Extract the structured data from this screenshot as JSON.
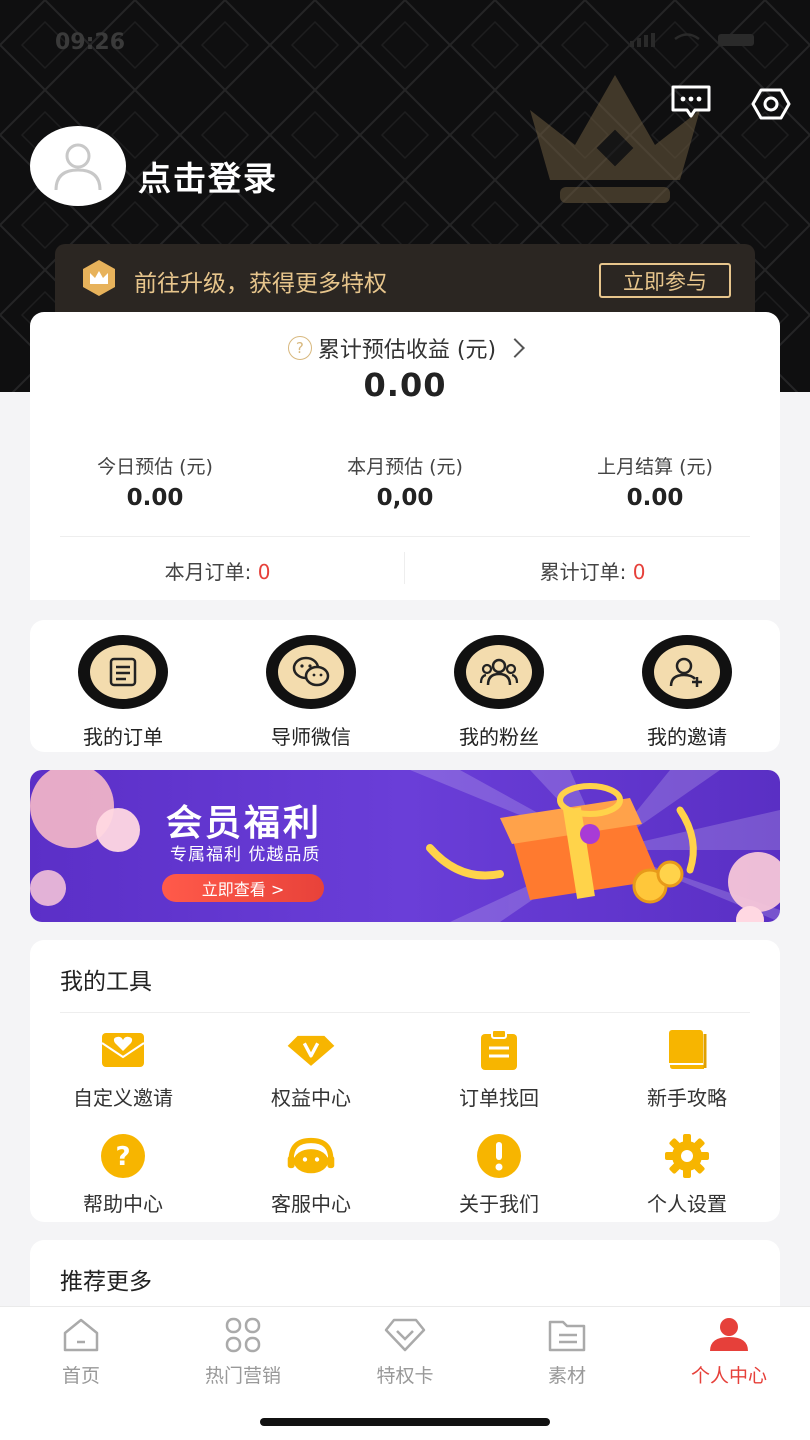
{
  "status_bar": {
    "time": "09:26"
  },
  "header": {
    "login_text": "点击登录",
    "upgrade_text": "前往升级，获得更多特权",
    "upgrade_button": "立即参与"
  },
  "earnings": {
    "total_label": "累计预估收益 (元)",
    "total_value": "0.00",
    "stats": [
      {
        "label": "今日预估 (元)",
        "value": "0.00"
      },
      {
        "label": "本月预估 (元)",
        "value": "0,00"
      },
      {
        "label": "上月结算 (元)",
        "value": "0.00"
      }
    ],
    "orders": [
      {
        "label": "本月订单: ",
        "value": "0"
      },
      {
        "label": "累计订单: ",
        "value": "0"
      }
    ]
  },
  "quick_actions": [
    {
      "label": "我的订单",
      "icon": "order-list-icon"
    },
    {
      "label": "导师微信",
      "icon": "wechat-icon"
    },
    {
      "label": "我的粉丝",
      "icon": "fans-icon"
    },
    {
      "label": "我的邀请",
      "icon": "invite-user-icon"
    }
  ],
  "banner": {
    "title": "会员福利",
    "subtitle": "专属福利 优越品质",
    "button": "立即查看 >"
  },
  "tools": {
    "title": "我的工具",
    "items": [
      {
        "label": "自定义邀请",
        "icon": "envelope-heart-icon"
      },
      {
        "label": "权益中心",
        "icon": "diamond-v-icon"
      },
      {
        "label": "订单找回",
        "icon": "clipboard-icon"
      },
      {
        "label": "新手攻略",
        "icon": "book-icon"
      },
      {
        "label": "帮助中心",
        "icon": "question-icon"
      },
      {
        "label": "客服中心",
        "icon": "headset-icon"
      },
      {
        "label": "关于我们",
        "icon": "exclamation-icon"
      },
      {
        "label": "个人设置",
        "icon": "gear-icon"
      }
    ]
  },
  "recommend": {
    "title": "推荐更多"
  },
  "tabbar": [
    {
      "label": "首页",
      "icon": "home-icon"
    },
    {
      "label": "热门营销",
      "icon": "grid-icon"
    },
    {
      "label": "特权卡",
      "icon": "diamond-icon"
    },
    {
      "label": "素材",
      "icon": "folder-icon"
    },
    {
      "label": "个人中心",
      "icon": "person-icon",
      "active": true
    }
  ],
  "colors": {
    "accent": "#e6403a",
    "gold": "#e7c58c",
    "tool_yellow": "#f7b500"
  }
}
